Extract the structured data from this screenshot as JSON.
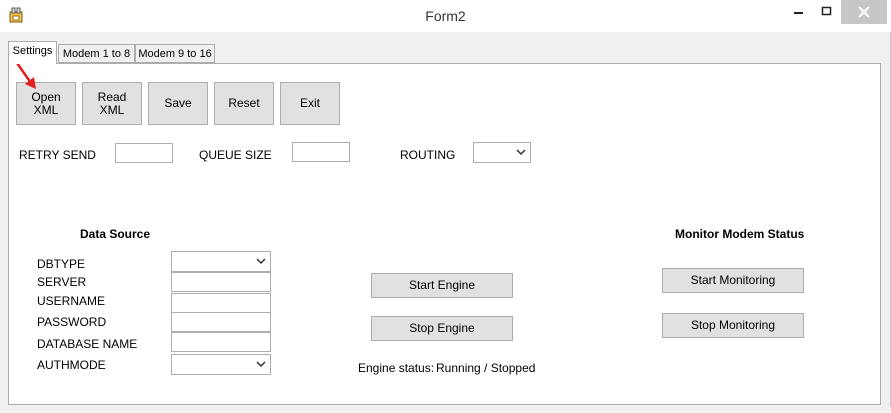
{
  "window": {
    "title": "Form2",
    "minimize_glyph": "—",
    "maximize_glyph": "☐",
    "close_glyph": "✕",
    "accent_arrow_color": "#e02020"
  },
  "tabs": [
    {
      "label": "Settings",
      "active": true
    },
    {
      "label": "Modem 1 to 8",
      "active": false
    },
    {
      "label": "Modem 9 to 16",
      "active": false
    }
  ],
  "toolbar": {
    "open_xml_line1": "Open",
    "open_xml_line2": "XML",
    "read_xml_line1": "Read",
    "read_xml_line2": "XML",
    "save_label": "Save",
    "reset_label": "Reset",
    "exit_label": "Exit"
  },
  "settings": {
    "retry_send_label": "RETRY SEND",
    "retry_send_value": "",
    "queue_size_label": "QUEUE SIZE",
    "queue_size_value": "",
    "routing_label": "ROUTING",
    "routing_value": ""
  },
  "data_source": {
    "heading": "Data Source",
    "dbtype_label": "DBTYPE",
    "server_label": "SERVER",
    "username_label": "USERNAME",
    "password_label": "PASSWORD",
    "database_name_label": "DATABASE NAME",
    "authmode_label": "AUTHMODE",
    "dbtype_value": "",
    "server_value": "",
    "username_value": "",
    "password_value": "",
    "database_name_value": "",
    "authmode_value": ""
  },
  "engine": {
    "start_label": "Start Engine",
    "stop_label": "Stop Engine",
    "status_label": "Engine status:",
    "status_value": "Running / Stopped"
  },
  "monitor": {
    "heading": "Monitor Modem Status",
    "start_label": "Start Monitoring",
    "stop_label": "Stop Monitoring"
  }
}
